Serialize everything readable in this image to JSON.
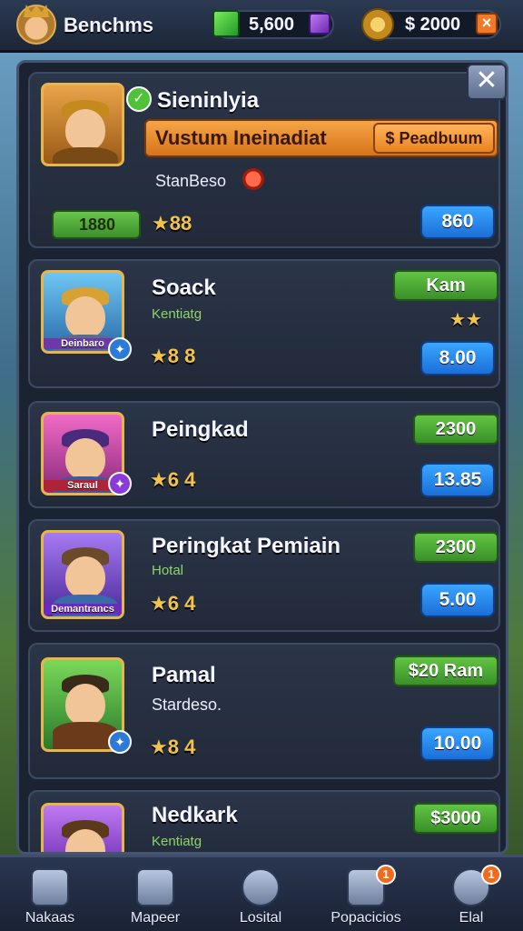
{
  "header": {
    "player_name": "Benchms",
    "gems_value": "5,600",
    "coins_value": "$ 2000",
    "add_label": "×"
  },
  "panel": {
    "close_label": "✕",
    "featured": {
      "name": "Sieninlyia",
      "banner_text": "Vustum Ineinadiat",
      "banner_pill": "$ Peadbuum",
      "subtitle": "StanBeso",
      "level": "1880",
      "stars": "★88",
      "price": "860",
      "check": "✓"
    },
    "list": [
      {
        "name": "Soack",
        "subtitle": "Kentiatg",
        "caption": "Deinbaro",
        "stars": "★8 8",
        "tag": "Kam",
        "extra_stars": "★★",
        "price": "8.00"
      },
      {
        "name": "Peingkad",
        "subtitle": "",
        "caption": "Saraul",
        "stars": "★6 4",
        "tag": "2300",
        "extra_stars": "",
        "price": "13.85"
      },
      {
        "name": "Peringkat  Pemiain",
        "subtitle": "Hotal",
        "caption": "Demantrancs",
        "stars": "★6 4",
        "tag": "2300",
        "extra_stars": "",
        "price": "5.00"
      },
      {
        "name": "Pamal",
        "subtitle": "Stardeso.",
        "caption": "",
        "stars": "★8 4",
        "tag": "$20 Ram",
        "extra_stars": "",
        "price": "10.00"
      },
      {
        "name": "Nedkark",
        "subtitle": "Kentiatg",
        "caption": "",
        "stars": "",
        "tag": "$3000",
        "extra_stars": "",
        "price": ""
      }
    ]
  },
  "nav": {
    "items": [
      {
        "label": "Nakaas",
        "badge": ""
      },
      {
        "label": "Mapeer",
        "badge": ""
      },
      {
        "label": "Losital",
        "badge": ""
      },
      {
        "label": "Popacicios",
        "badge": "1"
      },
      {
        "label": "Elal",
        "badge": "1"
      }
    ]
  },
  "colors": {
    "accent_blue": "#1b6fd8",
    "accent_green": "#3a9028",
    "accent_orange": "#d77419",
    "panel_bg": "#1b2332"
  }
}
